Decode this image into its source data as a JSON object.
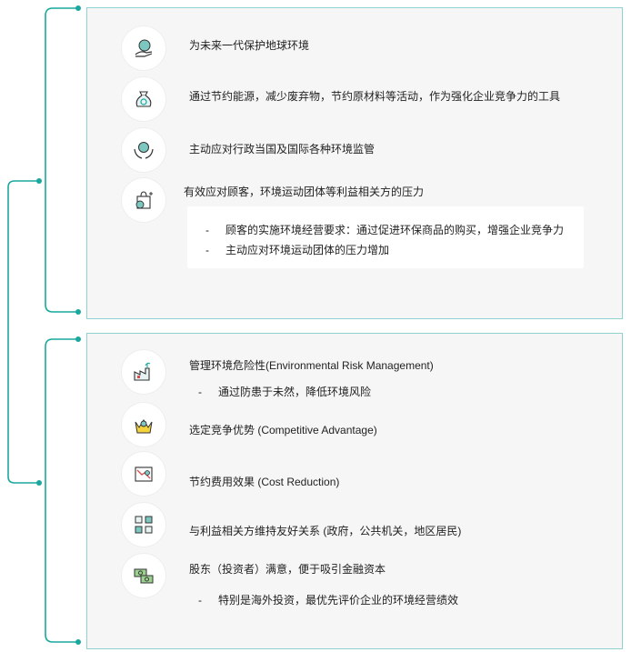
{
  "group1": {
    "items": [
      {
        "text": "为未来一代保护地球环境",
        "icon": "hand-globe-icon"
      },
      {
        "text": "通过节约能源，减少废弃物，节约原材料等活动，作为强化企业竞争力的工具",
        "icon": "recycle-bag-icon"
      },
      {
        "text": "主动应对行政当国及国际各种环境监管",
        "icon": "hands-globe-icon"
      },
      {
        "text": "有效应对顾客，环境运动团体等利益相关方的压力",
        "icon": "shopping-bag-globe-icon"
      }
    ],
    "sub_items": [
      "顾客的实施环境经营要求：通过促进环保商品的购买，增强企业竞争力",
      "主动应对环境运动团体的压力增加"
    ]
  },
  "group2": {
    "items": [
      {
        "text": "管理环境危险性(Environmental Risk Management)",
        "icon": "factory-icon"
      },
      {
        "text": "选定竞争优势 (Competitive Advantage)",
        "icon": "crown-person-icon"
      },
      {
        "text": "节约费用效果 (Cost Reduction)",
        "icon": "cost-down-chart-icon"
      },
      {
        "text": "与利益相关方维持友好关系 (政府，公共机关，地区居民)",
        "icon": "stakeholders-icon"
      },
      {
        "text": "股东（投资者）满意，便于吸引金融资本",
        "icon": "money-exchange-icon"
      }
    ],
    "sub_items": [
      "通过防患于未然，降低环境风险",
      "特别是海外投资，最优先评价企业的环境经营绩效"
    ]
  },
  "colors": {
    "accent": "#1aa89e",
    "panel_border": "#8fd3d0",
    "panel_bg": "#f6f6f6"
  }
}
